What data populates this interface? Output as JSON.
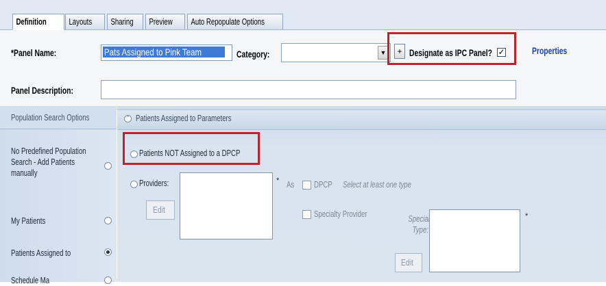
{
  "tabs": [
    {
      "label": "Definition",
      "active": true
    },
    {
      "label": "Layouts",
      "active": false
    },
    {
      "label": "Sharing",
      "active": false
    },
    {
      "label": "Preview",
      "active": false
    },
    {
      "label": "Auto Repopulate Options",
      "active": false
    }
  ],
  "form": {
    "panel_name_label": "*Panel Name:",
    "panel_name_value": "Pats Assigned to Pink Team",
    "category_label": "Category:",
    "category_value": "",
    "plus_label": "+",
    "ipc_label": "Designate as IPC Panel?",
    "ipc_checked": true,
    "properties_link": "Properties",
    "description_label": "Panel Description:",
    "description_value": ""
  },
  "nav": {
    "header": "Population Search Options",
    "items": [
      {
        "label": "No Predefined Population Search - Add Patients manually",
        "selected": false
      },
      {
        "label": "My Patients",
        "selected": false
      },
      {
        "label": "Patients Assigned to",
        "selected": true
      },
      {
        "label": "Schedule Ma",
        "selected": false
      }
    ]
  },
  "main": {
    "section_title": "Patients Assigned to Parameters",
    "not_assigned_label": "Patients NOT Assigned to a DPCP",
    "providers_label": "Providers:",
    "providers_required": "*",
    "as_label": "As",
    "dpcp_label": "DPCP",
    "select_hint": "Select at least one type",
    "specialty_provider_label": "Specialty Provider",
    "specialty_type_label": "Specialty Type:",
    "specialty_required": "*",
    "edit_label": "Edit"
  },
  "colors": {
    "highlight_red": "#c0212a",
    "selection_blue": "#3d7bd6",
    "properties_link": "#1f3fa8"
  }
}
